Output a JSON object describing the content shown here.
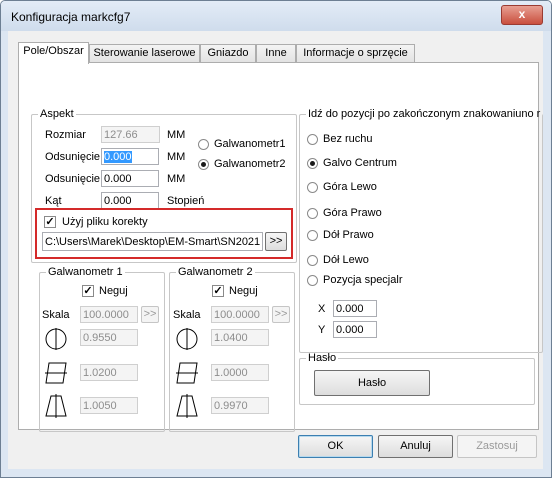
{
  "window": {
    "title": "Konfiguracja markcfg7",
    "close_glyph": "x"
  },
  "tabs": [
    {
      "label": "Pole/Obszar",
      "active": true
    },
    {
      "label": "Sterowanie laserowe"
    },
    {
      "label": "Gniazdo"
    },
    {
      "label": "Inne"
    },
    {
      "label": "Informacje o sprzęcie"
    }
  ],
  "aspekt": {
    "title": "Aspekt",
    "rozmiar": {
      "label": "Rozmiar",
      "value": "127.66",
      "unit": "MM"
    },
    "odsuniecie1": {
      "label": "Odsunięcie",
      "value": "0.000",
      "unit": "MM"
    },
    "odsuniecie2": {
      "label": "Odsunięcie",
      "value": "0.000",
      "unit": "MM"
    },
    "kat": {
      "label": "Kąt",
      "value": "0.000",
      "unit": "Stopień"
    },
    "galvo1_label": "Galwanometr1",
    "galvo2_label": "Galwanometr2",
    "selected_galvo": 2,
    "use_correction_label": "Użyj pliku korekty",
    "use_correction_checked": true,
    "correction_path": "C:\\Users\\Marek\\Desktop\\EM-Smart\\SN2021",
    "browse_label": ">>"
  },
  "galwanometr1": {
    "title": "Galwanometr 1",
    "neguj_label": "Neguj",
    "neguj_checked": true,
    "skala_label": "Skala",
    "skala_value": "100.0000",
    "skala_button": ">>",
    "val1": "0.9550",
    "val2": "1.0200",
    "val3": "1.0050"
  },
  "galwanometr2": {
    "title": "Galwanometr 2",
    "neguj_label": "Neguj",
    "neguj_checked": true,
    "skala_label": "Skala",
    "skala_value": "100.0000",
    "skala_button": ">>",
    "val1": "1.0400",
    "val2": "1.0000",
    "val3": "0.9970"
  },
  "goto": {
    "title": "Idź do pozycji po zakończonym znakowaniuno r",
    "options": [
      "Bez ruchu",
      "Galvo Centrum",
      "Góra Lewo",
      "Góra Prawo",
      "Dół Prawo",
      "Dół Lewo",
      "Pozycja specjalr"
    ],
    "selected_index": 1,
    "x_label": "X",
    "x_value": "0.000",
    "y_label": "Y",
    "y_value": "0.000"
  },
  "haslo": {
    "title": "Hasło",
    "button_label": "Hasło"
  },
  "footer": {
    "ok_label": "OK",
    "cancel_label": "Anuluj",
    "apply_label": "Zastosuj"
  },
  "colors": {
    "highlight_box": "#d42a2a",
    "selection": "#3399ff"
  }
}
